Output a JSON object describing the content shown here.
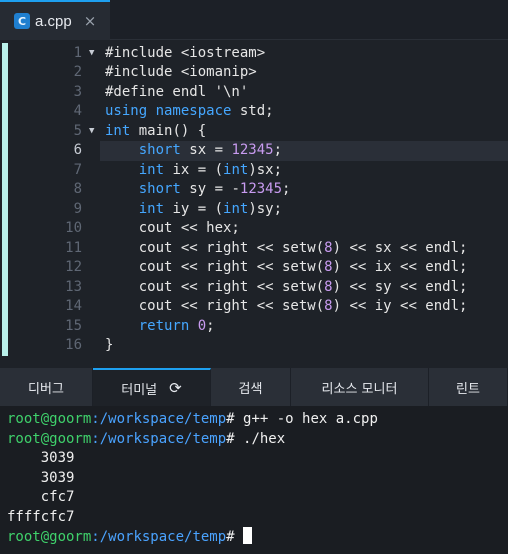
{
  "tab": {
    "icon_letter": "C",
    "filename": "a.cpp",
    "close_glyph": "×"
  },
  "editor": {
    "active_line": 6,
    "lines": [
      {
        "n": "1",
        "fold": true,
        "segs": [
          [
            "",
            "#include <iostream>"
          ]
        ]
      },
      {
        "n": "2",
        "fold": false,
        "segs": [
          [
            "",
            "#include <iomanip>"
          ]
        ]
      },
      {
        "n": "3",
        "fold": false,
        "segs": [
          [
            "",
            "#define endl '\\n'"
          ]
        ]
      },
      {
        "n": "4",
        "fold": false,
        "segs": [
          [
            "kw",
            "using namespace"
          ],
          [
            "",
            " std;"
          ]
        ]
      },
      {
        "n": "5",
        "fold": true,
        "segs": [
          [
            "kw",
            "int"
          ],
          [
            "",
            " main() {"
          ]
        ]
      },
      {
        "n": "6",
        "fold": false,
        "segs": [
          [
            "",
            "    "
          ],
          [
            "kw",
            "short"
          ],
          [
            "",
            " sx = "
          ],
          [
            "num",
            "12345"
          ],
          [
            "",
            ";"
          ]
        ]
      },
      {
        "n": "7",
        "fold": false,
        "segs": [
          [
            "",
            "    "
          ],
          [
            "kw",
            "int"
          ],
          [
            "",
            " ix = ("
          ],
          [
            "kw",
            "int"
          ],
          [
            "",
            ")sx;"
          ]
        ]
      },
      {
        "n": "8",
        "fold": false,
        "segs": [
          [
            "",
            "    "
          ],
          [
            "kw",
            "short"
          ],
          [
            "",
            " sy = -"
          ],
          [
            "num",
            "12345"
          ],
          [
            "",
            ";"
          ]
        ]
      },
      {
        "n": "9",
        "fold": false,
        "segs": [
          [
            "",
            "    "
          ],
          [
            "kw",
            "int"
          ],
          [
            "",
            " iy = ("
          ],
          [
            "kw",
            "int"
          ],
          [
            "",
            ")sy;"
          ]
        ]
      },
      {
        "n": "10",
        "fold": false,
        "segs": [
          [
            "",
            "    cout << hex;"
          ]
        ]
      },
      {
        "n": "11",
        "fold": false,
        "segs": [
          [
            "",
            "    cout << right << setw("
          ],
          [
            "num",
            "8"
          ],
          [
            "",
            ") << sx << endl;"
          ]
        ]
      },
      {
        "n": "12",
        "fold": false,
        "segs": [
          [
            "",
            "    cout << right << setw("
          ],
          [
            "num",
            "8"
          ],
          [
            "",
            ") << ix << endl;"
          ]
        ]
      },
      {
        "n": "13",
        "fold": false,
        "segs": [
          [
            "",
            "    cout << right << setw("
          ],
          [
            "num",
            "8"
          ],
          [
            "",
            ") << sy << endl;"
          ]
        ]
      },
      {
        "n": "14",
        "fold": false,
        "segs": [
          [
            "",
            "    cout << right << setw("
          ],
          [
            "num",
            "8"
          ],
          [
            "",
            ") << iy << endl;"
          ]
        ]
      },
      {
        "n": "15",
        "fold": false,
        "segs": [
          [
            "",
            "    "
          ],
          [
            "kw",
            "return"
          ],
          [
            "",
            " "
          ],
          [
            "num",
            "0"
          ],
          [
            "",
            ";"
          ]
        ]
      },
      {
        "n": "16",
        "fold": false,
        "segs": [
          [
            "",
            "}"
          ]
        ]
      }
    ]
  },
  "panel_tabs": [
    {
      "label": "디버그",
      "active": false,
      "width": 93
    },
    {
      "label": "터미널",
      "active": true,
      "width": 118,
      "icon": "refresh-icon",
      "icon_glyph": "⟳"
    },
    {
      "label": "검색",
      "active": false,
      "width": 80
    },
    {
      "label": "리소스 모니터",
      "active": false,
      "width": 138
    },
    {
      "label": "린트",
      "active": false,
      "width": 79
    }
  ],
  "terminal": {
    "lines": [
      {
        "kind": "prompt",
        "user": "root@goorm",
        "path": ":/workspace/temp",
        "cmd": "# g++ -o hex a.cpp"
      },
      {
        "kind": "prompt",
        "user": "root@goorm",
        "path": ":/workspace/temp",
        "cmd": "# ./hex"
      },
      {
        "kind": "output",
        "text": "    3039"
      },
      {
        "kind": "output",
        "text": "    3039"
      },
      {
        "kind": "output",
        "text": "    cfc7"
      },
      {
        "kind": "output",
        "text": "ffffcfc7"
      },
      {
        "kind": "prompt",
        "user": "root@goorm",
        "path": ":/workspace/temp",
        "cmd": "# ",
        "cursor": true
      }
    ]
  },
  "colors": {
    "accent": "#1ea0f0",
    "keyword": "#45a7ff",
    "number": "#c89bf0",
    "prompt_user": "#3fd16b",
    "prompt_path": "#4aa3ff"
  }
}
